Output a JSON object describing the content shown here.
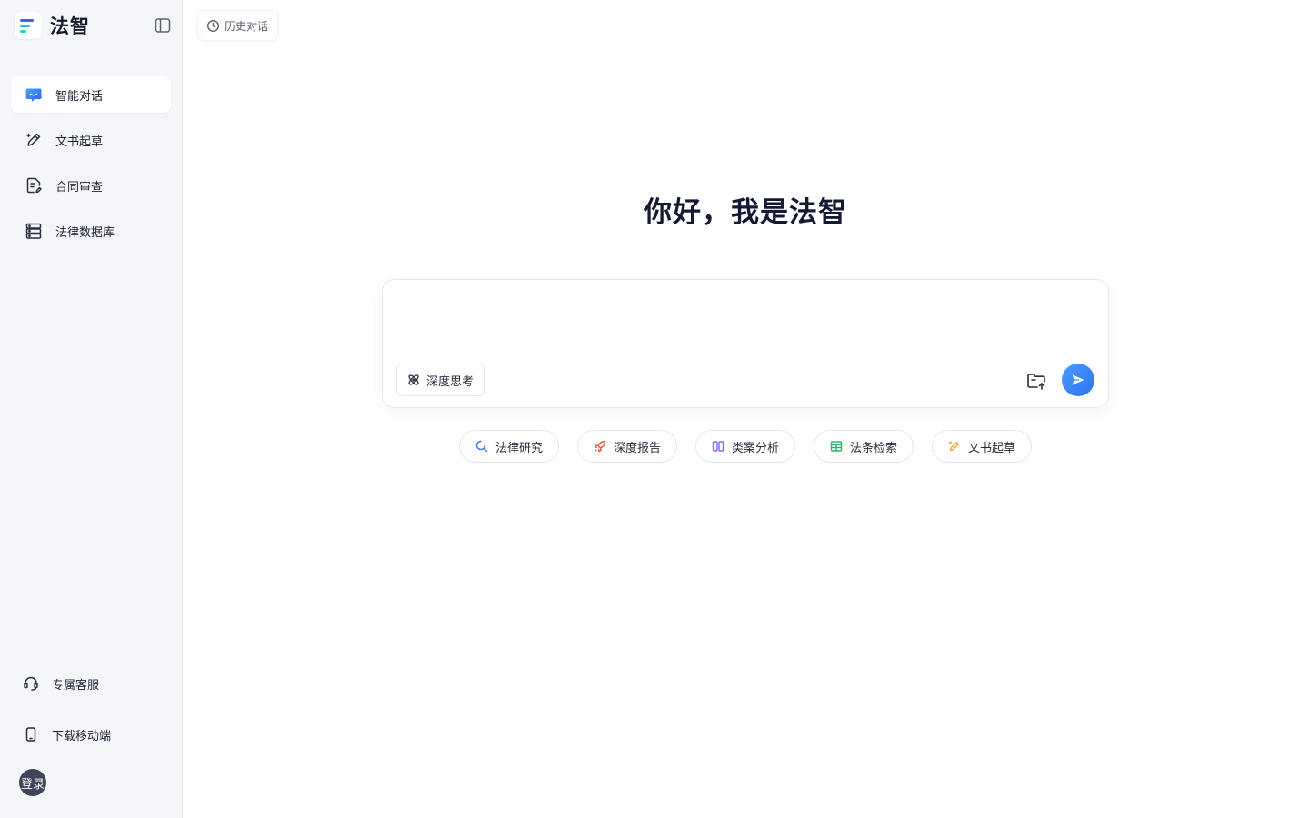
{
  "brand": {
    "name": "法智"
  },
  "sidebar": {
    "items": [
      {
        "label": "智能对话",
        "icon": "chat-bubble-icon",
        "active": true
      },
      {
        "label": "文书起草",
        "icon": "pen-icon",
        "active": false
      },
      {
        "label": "合同审查",
        "icon": "document-edit-icon",
        "active": false
      },
      {
        "label": "法律数据库",
        "icon": "database-icon",
        "active": false
      }
    ],
    "bottom": [
      {
        "label": "专属客服",
        "icon": "headset-icon"
      },
      {
        "label": "下载移动端",
        "icon": "phone-icon"
      }
    ],
    "login_label": "登录"
  },
  "header": {
    "history_label": "历史对话"
  },
  "main": {
    "greeting": "你好，我是法智",
    "input_placeholder": "",
    "deep_think_label": "深度思考",
    "chips": [
      {
        "label": "法律研究",
        "icon": "search-icon",
        "color": "#3a7bf0"
      },
      {
        "label": "深度报告",
        "icon": "rocket-icon",
        "color": "#f0503a"
      },
      {
        "label": "类案分析",
        "icon": "columns-icon",
        "color": "#8a5cf6"
      },
      {
        "label": "法条检索",
        "icon": "book-icon",
        "color": "#2fb56a"
      },
      {
        "label": "文书起草",
        "icon": "pen-icon",
        "color": "#f0a830"
      }
    ]
  },
  "colors": {
    "accent": "#2f6bff",
    "send": "#3a86f8",
    "sidebar_bg": "#f5f6fa",
    "title": "#141a33"
  }
}
